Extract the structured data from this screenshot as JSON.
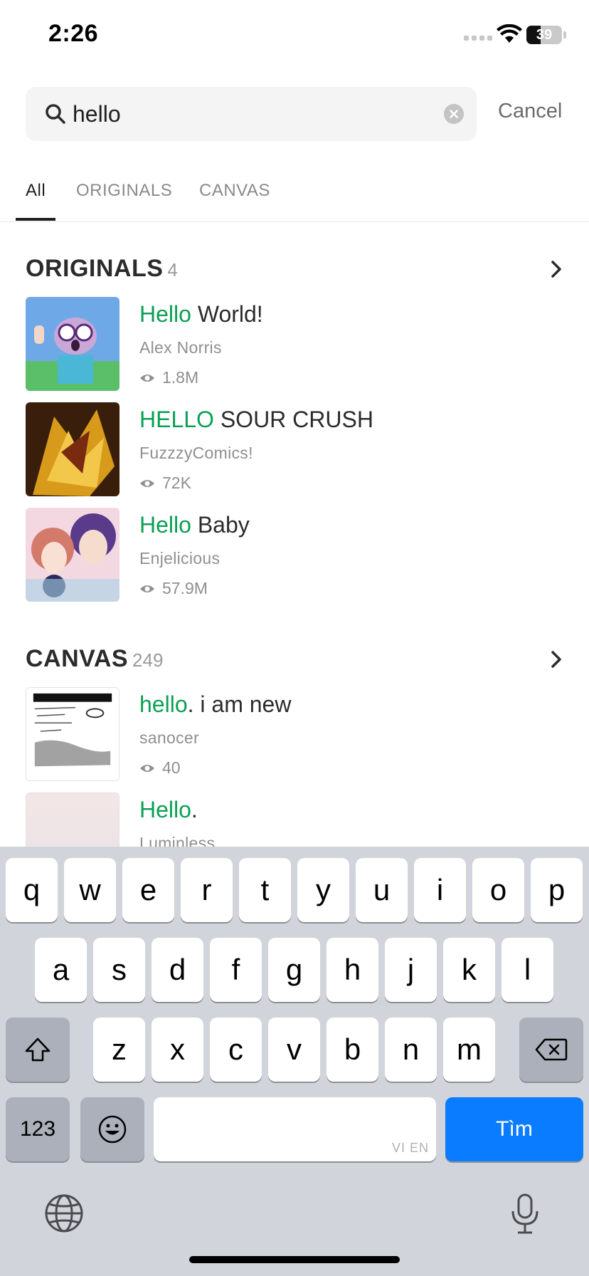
{
  "status": {
    "time": "2:26",
    "battery": "39",
    "battery_level": 0.39
  },
  "search": {
    "query": "hello",
    "placeholder": "",
    "cancel_label": "Cancel"
  },
  "tabs": [
    "All",
    "ORIGINALS",
    "CANVAS"
  ],
  "active_tab": "All",
  "originals": {
    "title": "ORIGINALS",
    "count": "4",
    "items": [
      {
        "title_highlight": "Hello",
        "title_rest": " World!",
        "author": "Alex Norris",
        "views": "1.8M"
      },
      {
        "title_highlight": "HELLO",
        "title_rest": " SOUR CRUSH",
        "author": "FuzzzyComics!",
        "views": "72K"
      },
      {
        "title_highlight": "Hello",
        "title_rest": " Baby",
        "author": "Enjelicious",
        "views": "57.9M"
      }
    ]
  },
  "canvas": {
    "title": "CANVAS",
    "count": "249",
    "items": [
      {
        "title_highlight": "hello",
        "title_rest": ". i am new",
        "author": "sanocer",
        "views": "40"
      },
      {
        "title_highlight": "Hello",
        "title_rest": ".",
        "author": "Luminless",
        "views": ""
      }
    ]
  },
  "keyboard": {
    "row1": [
      "q",
      "w",
      "e",
      "r",
      "t",
      "y",
      "u",
      "i",
      "o",
      "p"
    ],
    "row2": [
      "a",
      "s",
      "d",
      "f",
      "g",
      "h",
      "j",
      "k",
      "l"
    ],
    "row3": [
      "z",
      "x",
      "c",
      "v",
      "b",
      "n",
      "m"
    ],
    "numbers_label": "123",
    "space_hint": "VI EN",
    "return_label": "Tìm"
  },
  "colors": {
    "highlight": "#0aa055",
    "return_key": "#0a7cff",
    "keyboard_bg": "#d1d4da"
  },
  "icons": [
    "search-icon",
    "clear-icon",
    "chevron-right-icon",
    "eye-icon",
    "shift-icon",
    "backspace-icon",
    "emoji-icon",
    "globe-icon",
    "microphone-icon",
    "wifi-icon"
  ]
}
